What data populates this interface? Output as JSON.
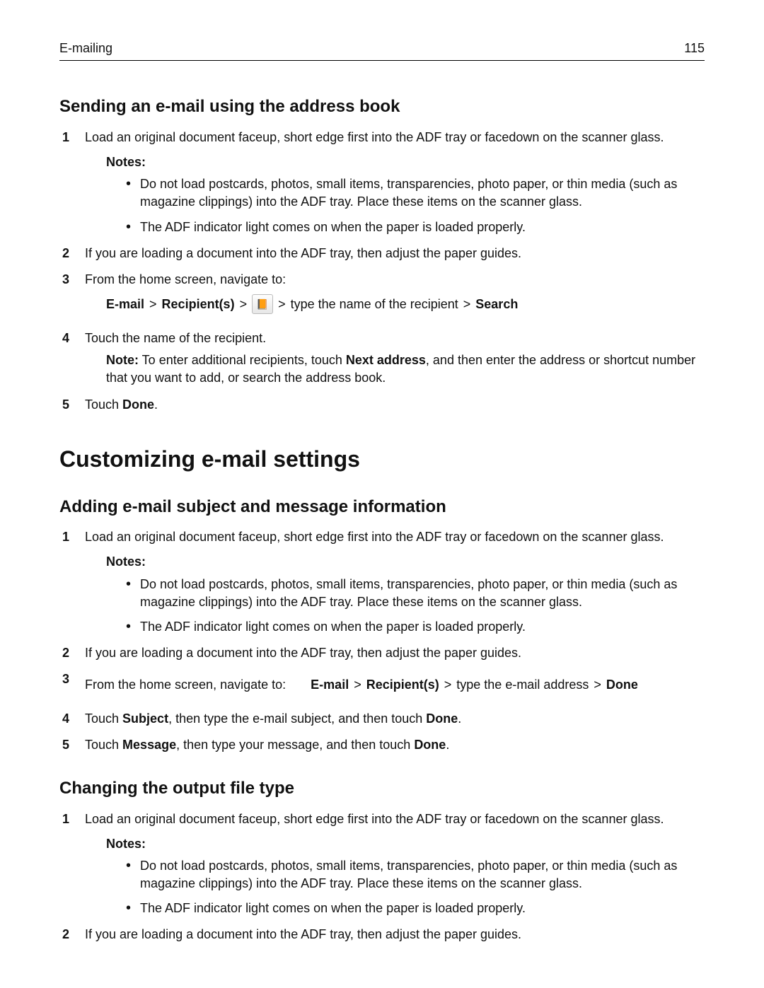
{
  "header": {
    "section": "E-mailing",
    "page_number": "115"
  },
  "section1": {
    "heading": "Sending an e-mail using the address book",
    "step1": "Load an original document faceup, short edge first into the ADF tray or facedown on the scanner glass.",
    "notes_label": "Notes:",
    "note_a": "Do not load postcards, photos, small items, transparencies, photo paper, or thin media (such as magazine clippings) into the ADF tray. Place these items on the scanner glass.",
    "note_b": "The ADF indicator light comes on when the paper is loaded properly.",
    "step2": "If you are loading a document into the ADF tray, then adjust the paper guides.",
    "step3": "From the home screen, navigate to:",
    "nav": {
      "email": "E-mail",
      "recipients": "Recipient(s)",
      "icon_glyph": "📙",
      "tail": "type the name of the recipient",
      "search": "Search"
    },
    "step4": "Touch the name of the recipient.",
    "step4_note_label": "Note:",
    "step4_note_a": " To enter additional recipients, touch ",
    "step4_note_next": "Next address",
    "step4_note_b": ", and then enter the address or shortcut number that you want to add, or search the address book.",
    "step5_a": "Touch ",
    "step5_done": "Done",
    "step5_b": "."
  },
  "section2": {
    "big_heading": "Customizing e-mail settings",
    "sub_a": {
      "heading": "Adding e-mail subject and message information",
      "step1": "Load an original document faceup, short edge first into the ADF tray or facedown on the scanner glass.",
      "notes_label": "Notes:",
      "note_a": "Do not load postcards, photos, small items, transparencies, photo paper, or thin media (such as magazine clippings) into the ADF tray. Place these items on the scanner glass.",
      "note_b": "The ADF indicator light comes on when the paper is loaded properly.",
      "step2": "If you are loading a document into the ADF tray, then adjust the paper guides.",
      "step3": "From the home screen, navigate to:",
      "nav": {
        "email": "E-mail",
        "recipients": "Recipient(s)",
        "tail": "type the e-mail address",
        "done": "Done"
      },
      "step4_a": "Touch ",
      "step4_subject": "Subject",
      "step4_b": ", then type the e-mail subject, and then touch ",
      "step4_done": "Done",
      "step4_c": ".",
      "step5_a": "Touch ",
      "step5_message": "Message",
      "step5_b": ", then type your message, and then touch ",
      "step5_done": "Done",
      "step5_c": "."
    },
    "sub_b": {
      "heading": "Changing the output file type",
      "step1": "Load an original document faceup, short edge first into the ADF tray or facedown on the scanner glass.",
      "notes_label": "Notes:",
      "note_a": "Do not load postcards, photos, small items, transparencies, photo paper, or thin media (such as magazine clippings) into the ADF tray. Place these items on the scanner glass.",
      "note_b": "The ADF indicator light comes on when the paper is loaded properly.",
      "step2": "If you are loading a document into the ADF tray, then adjust the paper guides."
    }
  }
}
